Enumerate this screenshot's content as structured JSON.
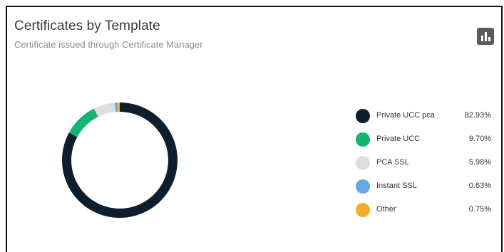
{
  "card": {
    "title": "Certificates by Template",
    "subtitle": "Certificate issued through Certificate Manager"
  },
  "toolbar": {
    "chart_toggle_icon": "bar-chart-icon"
  },
  "chart_data": {
    "type": "pie",
    "variant": "donut",
    "title": "",
    "categories": [
      "Private UCC pca",
      "Private UCC",
      "PCA SSL",
      "Instant SSL",
      "Other"
    ],
    "values": [
      82.93,
      9.7,
      5.98,
      0.63,
      0.75
    ],
    "value_labels": [
      "82.93%",
      "9.70%",
      "5.98%",
      "0.63%",
      "0.75%"
    ],
    "colors": [
      "#0d1e2d",
      "#14b573",
      "#dedede",
      "#64a9e4",
      "#f2ae2b"
    ],
    "legend_position": "right"
  }
}
